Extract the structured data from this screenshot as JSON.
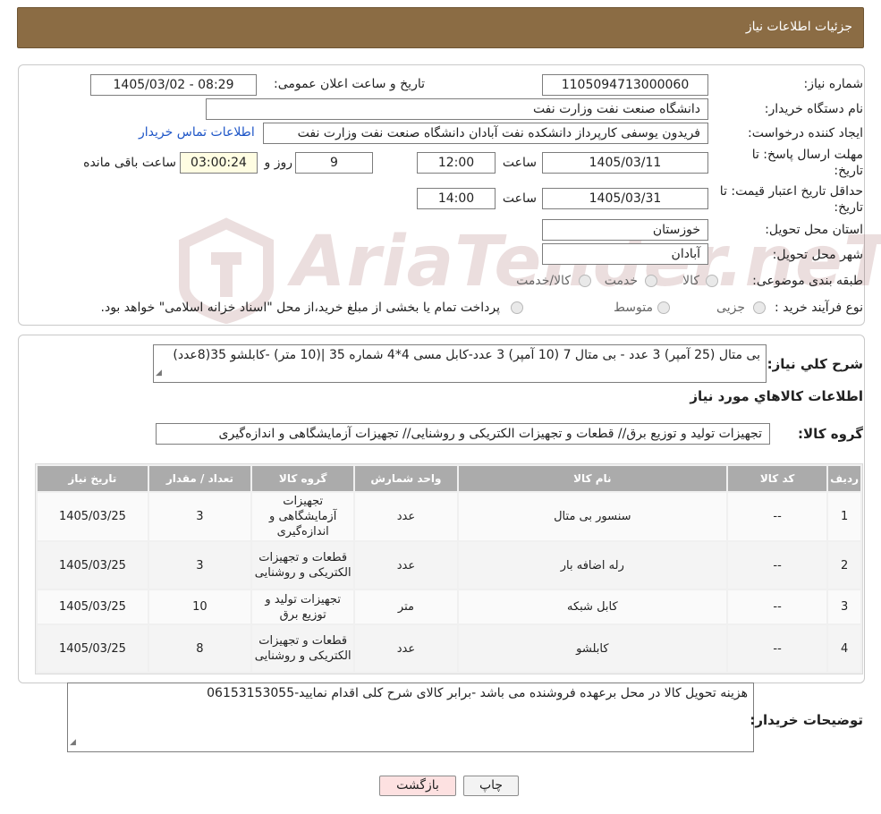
{
  "header": {
    "title": "جزئیات اطلاعات نیاز"
  },
  "info": {
    "need_number_label": "شماره نیاز:",
    "need_number": "1105094713000060",
    "announce_label": "تاریخ و ساعت اعلان عمومی:",
    "announce_value": "1405/03/02 - 08:29",
    "buyer_org_label": "نام دستگاه خریدار:",
    "buyer_org": "دانشگاه صنعت نفت وزارت نفت",
    "creator_label": "ایجاد کننده درخواست:",
    "creator": "فریدون یوسفی کارپرداز دانشکده نفت آبادان دانشگاه صنعت نفت وزارت نفت",
    "contact_link": "اطلاعات تماس خریدار",
    "deadline_label_1": "مهلت ارسال پاسخ: تا",
    "deadline_label_2": "تاریخ:",
    "deadline_date": "1405/03/11",
    "time_label": "ساعت",
    "deadline_time": "12:00",
    "days_value": "9",
    "days_label": "روز و",
    "remaining_time": "03:00:24",
    "remaining_label": "ساعت باقی مانده",
    "validity_label_1": "حداقل تاریخ اعتبار قیمت: تا",
    "validity_label_2": "تاریخ:",
    "validity_date": "1405/03/31",
    "validity_time": "14:00",
    "province_label": "استان محل تحویل:",
    "province": "خوزستان",
    "city_label": "شهر محل تحویل:",
    "city": "آبادان",
    "category_label": "طبقه بندی موضوعی:",
    "category_options": [
      "کالا",
      "خدمت",
      "کالا/خدمت"
    ],
    "process_label": "نوع فرآیند خرید :",
    "process_options": [
      "جزیی",
      "متوسط"
    ],
    "process_note": "پرداخت تمام یا بخشی از مبلغ خرید،از محل \"اسناد خزانه اسلامی\" خواهد بود."
  },
  "watermark": {
    "text": "AriaTender.neT"
  },
  "summary": {
    "label": "شرح کلي نياز:",
    "text": "بی متال (25 آمپر) 3 عدد - بی متال 7 (10 آمپر) 3 عدد-کابل مسی 4*4 شماره 35 |(10 متر) -کابلشو 35(8عدد)"
  },
  "goods_section": {
    "title": "اطلاعات کالاهاي مورد نياز"
  },
  "goods_group": {
    "label": "گروه کالا:",
    "value": "تجهیزات تولید و توزیع برق// قطعات و تجهیزات الکتریکی و روشنایی// تجهیزات آزمایشگاهی و اندازه‌گیری"
  },
  "table": {
    "headers": [
      "ردیف",
      "کد کالا",
      "نام کالا",
      "واحد شمارش",
      "گروه کالا",
      "تعداد / مقدار",
      "تاریخ نیاز"
    ],
    "rows": [
      [
        "1",
        "--",
        "سنسور بی متال",
        "عدد",
        "تجهیزات آزمایشگاهی و اندازه‌گیری",
        "3",
        "1405/03/25"
      ],
      [
        "2",
        "--",
        "رله اضافه بار",
        "عدد",
        "قطعات و تجهیزات الکتریکی و روشنایی",
        "3",
        "1405/03/25"
      ],
      [
        "3",
        "--",
        "کابل شبکه",
        "متر",
        "تجهیزات تولید و توزیع برق",
        "10",
        "1405/03/25"
      ],
      [
        "4",
        "--",
        "کابلشو",
        "عدد",
        "قطعات و تجهیزات الکتریکی و روشنایی",
        "8",
        "1405/03/25"
      ]
    ]
  },
  "buyer_notes": {
    "label": "توضیحات خریدار:",
    "text": "هزینه تحویل کالا در محل برعهده فروشنده می باشد -برابر کالای شرح کلی اقدام نمایید-06153153055"
  },
  "buttons": {
    "print": "چاپ",
    "back": "بازگشت"
  },
  "colors": {
    "header_bg": "#8b6c44",
    "link": "#1d55c7",
    "table_header": "#ababab",
    "back_button": "#fde1e1"
  }
}
